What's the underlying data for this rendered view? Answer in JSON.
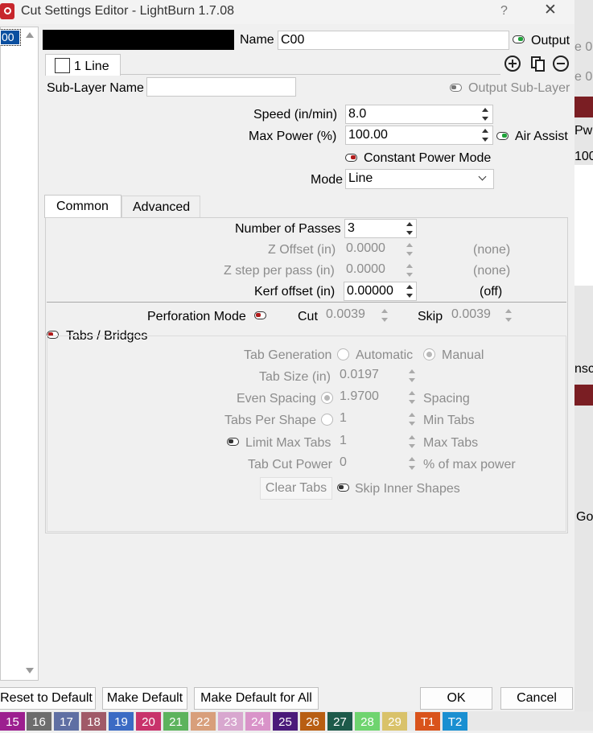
{
  "window": {
    "title": "Cut Settings Editor - LightBurn 1.7.08",
    "help": "?",
    "close": "✕"
  },
  "left_list": {
    "selected_item": "00"
  },
  "header": {
    "name_label": "Name",
    "name_value": "C00",
    "output_label": "Output",
    "layer_tab_label": "1 Line",
    "sublayer_name_label": "Sub-Layer Name",
    "sublayer_name_value": "",
    "output_sublayer_label": "Output Sub-Layer"
  },
  "main": {
    "speed_label": "Speed (in/min)",
    "speed_value": "8.0",
    "max_power_label": "Max Power (%)",
    "max_power_value": "100.00",
    "air_assist_label": "Air Assist",
    "constant_power_label": "Constant Power Mode",
    "mode_label": "Mode",
    "mode_value": "Line"
  },
  "tabs": {
    "common": "Common",
    "advanced": "Advanced"
  },
  "common": {
    "passes_label": "Number of Passes",
    "passes_value": "3",
    "z_offset_label": "Z Offset (in)",
    "z_offset_value": "0.0000",
    "z_offset_status": "(none)",
    "z_step_label": "Z step per pass (in)",
    "z_step_value": "0.0000",
    "z_step_status": "(none)",
    "kerf_label": "Kerf offset (in)",
    "kerf_value": "0.00000",
    "kerf_status": "(off)"
  },
  "perforation": {
    "label": "Perforation Mode",
    "cut_label": "Cut",
    "cut_value": "0.0039",
    "skip_label": "Skip",
    "skip_value": "0.0039"
  },
  "tabs_bridges": {
    "label": "Tabs / Bridges",
    "generation_label": "Tab Generation",
    "automatic": "Automatic",
    "manual": "Manual",
    "tab_size_label": "Tab Size (in)",
    "tab_size_value": "0.0197",
    "even_spacing_label": "Even Spacing",
    "even_spacing_value": "1.9700",
    "spacing_suffix": "Spacing",
    "tabs_per_shape_label": "Tabs Per Shape",
    "tabs_per_shape_value": "1",
    "min_tabs_suffix": "Min Tabs",
    "limit_max_label": "Limit Max Tabs",
    "limit_max_value": "1",
    "max_tabs_suffix": "Max Tabs",
    "cut_power_label": "Tab Cut Power",
    "cut_power_value": "0",
    "cut_power_suffix": "% of max power",
    "clear_tabs": "Clear Tabs",
    "skip_inner_label": "Skip Inner Shapes"
  },
  "footer": {
    "reset": "Reset to Default",
    "make_default": "Make Default",
    "make_default_all": "Make Default for All",
    "ok": "OK",
    "cancel": "Cancel"
  },
  "background_peek": {
    "e1": "e 0",
    "e2": "e 0",
    "pw": "Pw",
    "v100": "100",
    "nsc": "nsc",
    "go": "Go"
  },
  "palette": [
    {
      "label": "15",
      "color": "#9c1f8f"
    },
    {
      "label": "16",
      "color": "#6d6d6d"
    },
    {
      "label": "17",
      "color": "#5f6fa3"
    },
    {
      "label": "18",
      "color": "#a05a68"
    },
    {
      "label": "19",
      "color": "#3b6bc4"
    },
    {
      "label": "20",
      "color": "#c8336b"
    },
    {
      "label": "21",
      "color": "#5db35d"
    },
    {
      "label": "22",
      "color": "#d89f7b"
    },
    {
      "label": "23",
      "color": "#d8a7cf"
    },
    {
      "label": "24",
      "color": "#d993c9"
    },
    {
      "label": "25",
      "color": "#4a1a7a"
    },
    {
      "label": "26",
      "color": "#b85e12"
    },
    {
      "label": "27",
      "color": "#1d5a4a"
    },
    {
      "label": "28",
      "color": "#6fd46f"
    },
    {
      "label": "29",
      "color": "#d9c26a"
    },
    {
      "label": "T1",
      "color": "#d9531b"
    },
    {
      "label": "T2",
      "color": "#1a8fd1"
    }
  ],
  "colors": {
    "accent_green": "#1fa33a",
    "accent_red": "#b01a1a",
    "selection_blue": "#0a4fa0"
  }
}
